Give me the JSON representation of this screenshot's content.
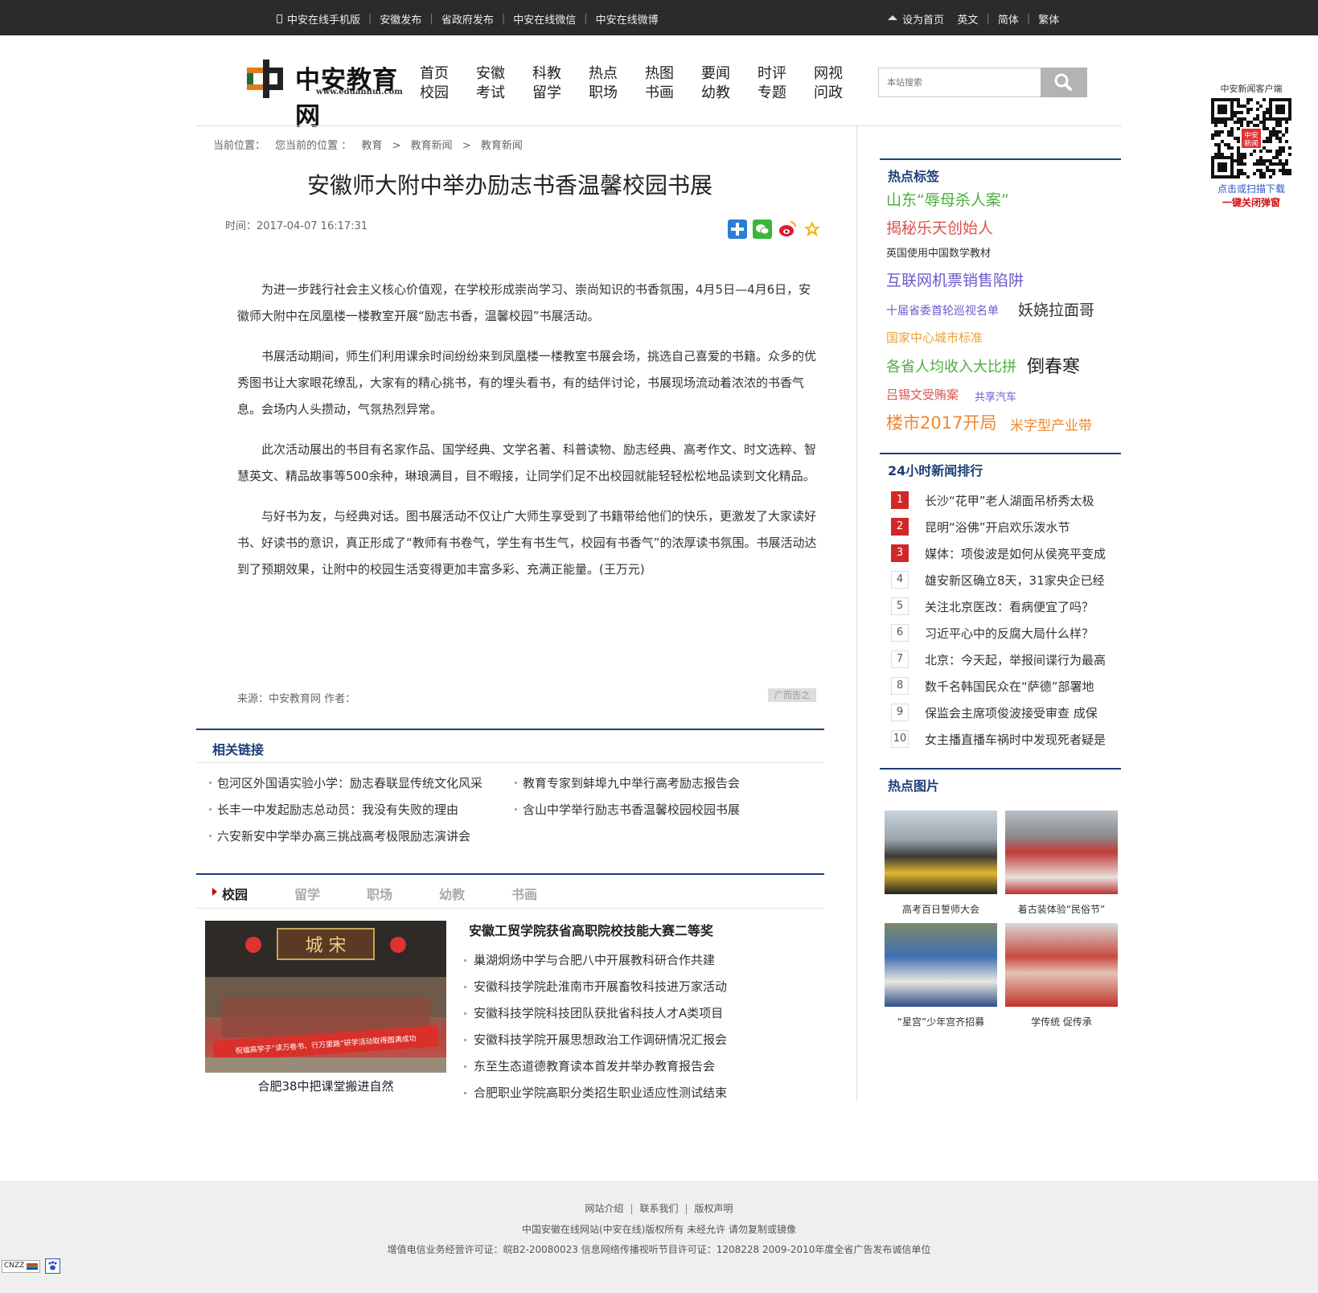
{
  "topbar": {
    "left_links": [
      "中安在线手机版",
      "安徽发布",
      "省政府发布",
      "中安在线微信",
      "中安在线微博"
    ],
    "right_links": [
      "设为首页",
      "英文",
      "简体",
      "繁体"
    ]
  },
  "logo": {
    "name": "中安教育网",
    "url": "www.eduanhui.com"
  },
  "nav": [
    [
      "首页",
      "校园"
    ],
    [
      "安徽",
      "考试"
    ],
    [
      "科教",
      "留学"
    ],
    [
      "热点",
      "职场"
    ],
    [
      "热图",
      "书画"
    ],
    [
      "要闻",
      "幼教"
    ],
    [
      "时评",
      "专题"
    ],
    [
      "网视",
      "问政"
    ]
  ],
  "search": {
    "placeholder": "本站搜索"
  },
  "qr": {
    "title": "中安新闻客户端",
    "scan": "点击或扫描下载",
    "close": "一键关闭弹窗",
    "inner": "中安\n新闻"
  },
  "breadcrumb": {
    "label": "当前位置：",
    "path": [
      "您当前的位置 ：",
      "教育",
      ">",
      "教育新闻",
      ">",
      "教育新闻"
    ]
  },
  "article": {
    "title": "安徽师大附中举办励志书香温馨校园书展",
    "time": "时间：2017-04-07 16:17:31",
    "paragraphs": [
      "为进一步践行社会主义核心价值观，在学校形成崇尚学习、崇尚知识的书香氛围，4月5日—4月6日，安徽师大附中在凤凰楼一楼教室开展“励志书香，温馨校园”书展活动。",
      "书展活动期间，师生们利用课余时间纷纷来到凤凰楼一楼教室书展会场，挑选自己喜爱的书籍。众多的优秀图书让大家眼花缭乱，大家有的精心挑书，有的埋头看书，有的结伴讨论，书展现场流动着浓浓的书香气息。会场内人头攒动，气氛热烈异常。",
      "此次活动展出的书目有名家作品、国学经典、文学名著、科普读物、励志经典、高考作文、时文选粹、智慧英文、精品故事等500余种，琳琅满目，目不暇接，让同学们足不出校园就能轻轻松松地品读到文化精品。",
      "与好书为友，与经典对话。图书展活动不仅让广大师生享受到了书籍带给他们的快乐，更激发了大家读好书、好读书的意识，真正形成了“教师有书卷气，学生有书生气，校园有书香气”的浓厚读书氛围。书展活动达到了预期效果，让附中的校园生活变得更加丰富多彩、充满正能量。(王万元)"
    ],
    "source": "来源：中安教育网  作者：",
    "ad": "广而告之"
  },
  "related": {
    "title": "相关链接",
    "items": [
      "包河区外国语实验小学：励志春联显传统文化风采",
      "教育专家到蚌埠九中举行高考励志报告会",
      "长丰一中发起励志总动员：我没有失败的理由",
      "含山中学举行励志书香温馨校园校园书展",
      "六安新安中学举办高三挑战高考极限励志演讲会"
    ]
  },
  "campus": {
    "tabs": [
      "校园",
      "留学",
      "职场",
      "幼教",
      "书画"
    ],
    "image_caption": "合肥38中把课堂搬进自然",
    "image_banner": "祝福高学子“读万卷书、行万里路”研学活动取得圆满成功",
    "image_plaque": "城 宋",
    "lead": "安徽工贸学院获省高职院校技能大赛二等奖",
    "items": [
      "巢湖炯炀中学与合肥八中开展教科研合作共建",
      "安徽科技学院赴淮南市开展畜牧科技进万家活动",
      "安徽科技学院科技团队获批省科技人才A类项目",
      "安徽科技学院开展思想政治工作调研情况汇报会",
      "东至生态道德教育读本首发并举办教育报告会",
      "合肥职业学院高职分类招生职业适应性测试结束"
    ]
  },
  "hot_tags": {
    "title": "热点标签",
    "tags": [
      {
        "text": "山东“辱母杀人案”",
        "color": "#4caf3c"
      },
      {
        "text": "揭秘乐天创始人",
        "color": "#d9534f"
      },
      {
        "text": "英国使用中国数学教材",
        "color": "#333333"
      },
      {
        "text": "互联网机票销售陷阱",
        "color": "#6a5acd"
      },
      {
        "text": "十届省委首轮巡视名单",
        "color": "#6a5acd"
      },
      {
        "text": "妖娆拉面哥",
        "color": "#333333"
      },
      {
        "text": "国家中心城市标准",
        "color": "#e8a23a"
      },
      {
        "text": "各省人均收入大比拼",
        "color": "#4caf3c"
      },
      {
        "text": "倒春寒",
        "color": "#222222"
      },
      {
        "text": "吕锡文受贿案",
        "color": "#d9534f"
      },
      {
        "text": "共享汽车",
        "color": "#6a5acd"
      },
      {
        "text": "楼市2017开局",
        "color": "#f0862e"
      },
      {
        "text": "米字型产业带",
        "color": "#f0862e"
      }
    ]
  },
  "ranking": {
    "title": "24小时新闻排行",
    "items": [
      "长沙“花甲”老人湖面吊桥秀太极",
      "昆明“浴佛”开启欢乐泼水节",
      "媒体：项俊波是如何从侯亮平变成",
      "雄安新区确立8天，31家央企已经",
      "关注北京医改：看病便宜了吗？",
      "习近平心中的反腐大局什么样？",
      "北京：今天起，举报间谍行为最高",
      "数千名韩国民众在“萨德”部署地",
      "保监会主席项俊波接受审查 成保",
      "女主播直播车祸时中发现死者疑是"
    ]
  },
  "hot_pics": {
    "title": "热点图片",
    "captions": [
      "高考百日誓师大会",
      "着古装体验“民俗节”",
      "“星宫”少年宫齐招募",
      "学传统 促传承"
    ]
  },
  "footer": {
    "links": [
      "网站介绍",
      "联系我们",
      "版权声明"
    ],
    "copyright": "中国安徽在线网站(中安在线)版权所有 未经允许 请勿复制或镜像",
    "license": "增值电信业务经营许可证：皖B2-20080023 信息网络传播视听节目许可证：1208228   2009-2010年度全省广告发布诚信单位",
    "badge": "CNZZ"
  },
  "colors": {
    "accent": "#1d3e78",
    "topbar": "#2b2b2b",
    "hot_rank": "#d02828",
    "footer_bg": "#efefef"
  }
}
